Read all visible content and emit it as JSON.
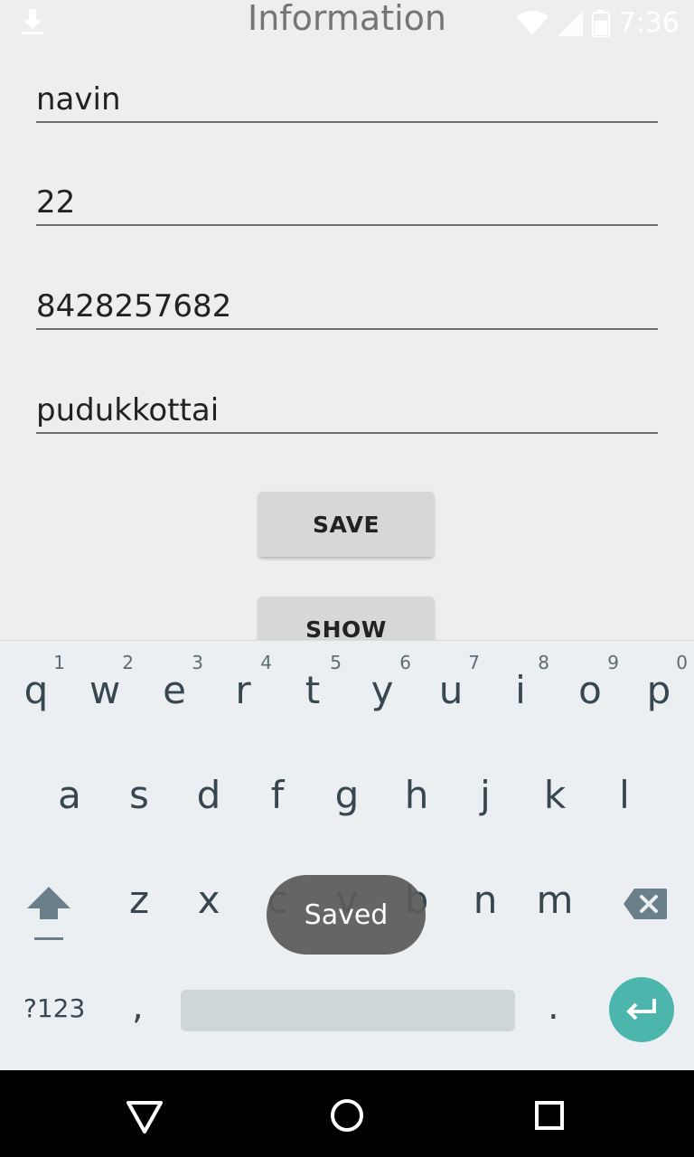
{
  "status_bar": {
    "time": "7:36"
  },
  "header": {
    "title": "Information"
  },
  "form": {
    "name_value": "navin",
    "age_value": "22",
    "phone_value": "8428257682",
    "city_value": "pudukkottai",
    "save_label": "SAVE",
    "show_label": "SHOW"
  },
  "keyboard": {
    "row1": [
      {
        "ch": "q",
        "hint": "1"
      },
      {
        "ch": "w",
        "hint": "2"
      },
      {
        "ch": "e",
        "hint": "3"
      },
      {
        "ch": "r",
        "hint": "4"
      },
      {
        "ch": "t",
        "hint": "5"
      },
      {
        "ch": "y",
        "hint": "6"
      },
      {
        "ch": "u",
        "hint": "7"
      },
      {
        "ch": "i",
        "hint": "8"
      },
      {
        "ch": "o",
        "hint": "9"
      },
      {
        "ch": "p",
        "hint": "0"
      }
    ],
    "row2": [
      "a",
      "s",
      "d",
      "f",
      "g",
      "h",
      "j",
      "k",
      "l"
    ],
    "row3": [
      "z",
      "x",
      "c",
      "v",
      "b",
      "n",
      "m"
    ],
    "symbols_label": "?123",
    "comma": ",",
    "period": "."
  },
  "toast": {
    "text": "Saved"
  },
  "icons": {
    "download": "download-icon",
    "wifi": "wifi-icon",
    "signal": "signal-icon",
    "battery": "battery-icon",
    "shift": "shift-icon",
    "backspace": "backspace-icon",
    "enter": "enter-icon",
    "back": "back-icon",
    "home": "home-icon",
    "recents": "recents-icon"
  },
  "colors": {
    "accent": "#4db6ac",
    "keyboard_bg": "#eceff1",
    "app_bg": "#eeeeee"
  }
}
